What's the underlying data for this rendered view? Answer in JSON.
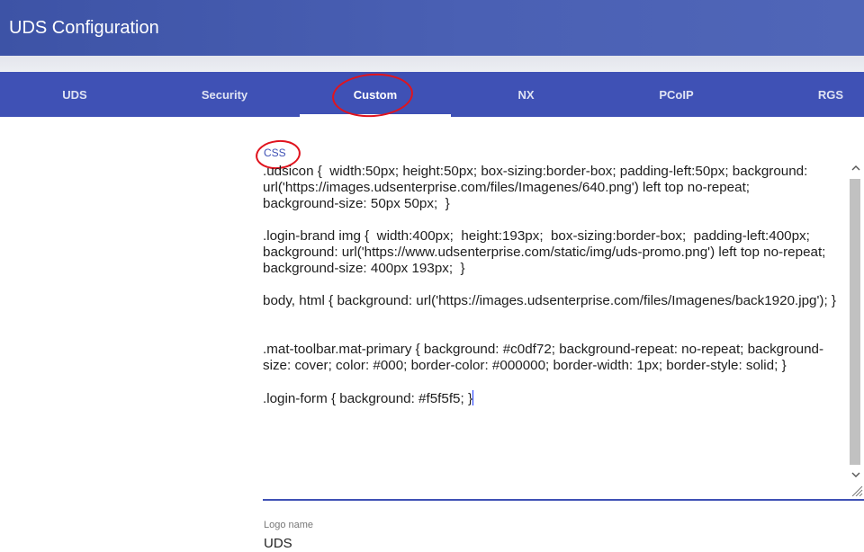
{
  "app": {
    "title": "UDS Configuration"
  },
  "tabs": [
    {
      "label": "UDS",
      "active": false
    },
    {
      "label": "Security",
      "active": false
    },
    {
      "label": "Custom",
      "active": true
    },
    {
      "label": "NX",
      "active": false
    },
    {
      "label": "PCoIP",
      "active": false
    },
    {
      "label": "RGS",
      "active": false
    }
  ],
  "css_field": {
    "label": "CSS",
    "blocks": [
      ".udsicon {  width:50px; height:50px; box-sizing:border-box; padding-left:50px; background: url('https://images.udsenterprise.com/files/Imagenes/640.png') left top no-repeat;\nbackground-size: 50px 50px;  }",
      ".login-brand img {  width:400px;  height:193px;  box-sizing:border-box;  padding-left:400px;  background: url('https://www.udsenterprise.com/static/img/uds-promo.png') left top no-repeat;  background-size: 400px 193px;  }",
      "body, html { background: url('https://images.udsenterprise.com/files/Imagenes/back1920.jpg'); }",
      ".mat-toolbar.mat-primary { background: #c0df72; background-repeat: no-repeat; background-size: cover; color: #000; border-color: #000000; border-width: 1px; border-style: solid; }",
      ".login-form { background: #f5f5f5; }"
    ]
  },
  "logo_field": {
    "label": "Logo name",
    "value": "UDS"
  },
  "icons": {
    "scroll_up": "chevron-up-icon",
    "scroll_down": "chevron-down-icon",
    "resize": "resize-grip-icon"
  },
  "colors": {
    "primary": "#3f51b5",
    "annotation": "#e0141e"
  }
}
